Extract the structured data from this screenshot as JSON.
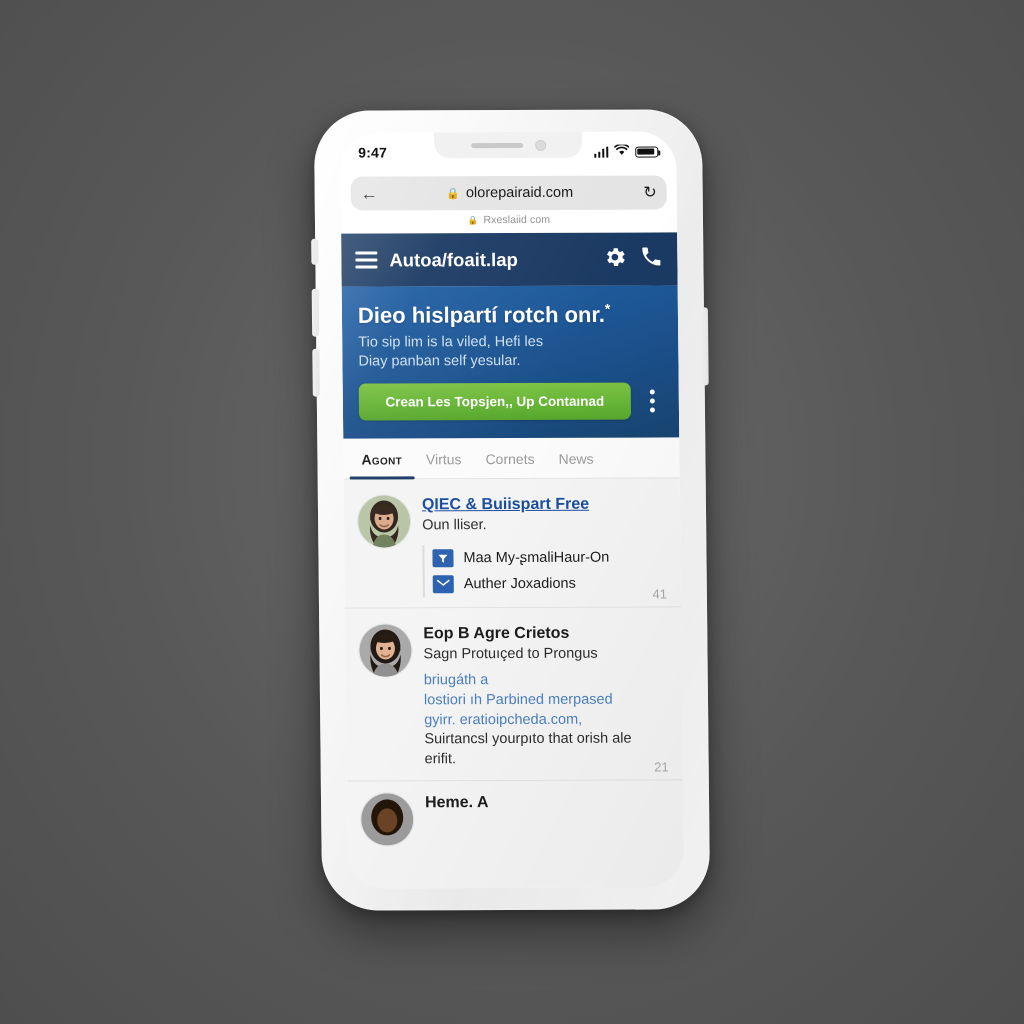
{
  "device": {
    "status_bar": {
      "time": "9:47",
      "signal_icon": "cellular-bars-icon",
      "wifi_icon": "wifi-icon",
      "battery_icon": "battery-icon"
    },
    "notch": {
      "speaker_icon": "speaker-grille-icon",
      "camera_icon": "front-camera-icon"
    },
    "buttons": {
      "silent_switch": "silent-switch",
      "volume_up": "volume-up-button",
      "volume_down": "volume-down-button",
      "power": "power-button"
    }
  },
  "browser": {
    "back_icon": "back-arrow-icon",
    "lock_icon": "lock-icon",
    "url": "olorepairaid.com",
    "reload_icon": "reload-icon",
    "sub_lock_icon": "lock-icon",
    "sub_url": "Rxeslaiid com"
  },
  "site_header": {
    "menu_icon": "hamburger-menu-icon",
    "title": "Autoa/foait.lap",
    "settings_icon": "gear-icon",
    "phone_icon": "phone-icon"
  },
  "hero": {
    "title": "Dieo hislpartí rotch onr.",
    "title_superscript": "*",
    "subtitle_line1": "Tio sip lim is la viled, Hefi les",
    "subtitle_line2": "Diay panban self yesular.",
    "cta_label": "Crean Les Topsjen,, Up Contaınad",
    "overflow_icon": "more-vertical-icon",
    "cta_color": "#68b637",
    "background_color": "#1d5796",
    "header_color": "#1b3a63"
  },
  "tabs": [
    {
      "label": "Agont",
      "active": true
    },
    {
      "label": "Virtus",
      "active": false
    },
    {
      "label": "Cornets",
      "active": false
    },
    {
      "label": "News",
      "active": false
    }
  ],
  "list": [
    {
      "avatar": "woman-avatar-1",
      "link_title": "QIEC & Buiispart Free",
      "subtitle": "Oun lliser.",
      "meta": [
        {
          "icon": "filter-badge-icon",
          "text": "Maa My-ʂmaliHaur-On"
        },
        {
          "icon": "envelope-icon",
          "text": "Auther Joxadions"
        }
      ],
      "count": "41"
    },
    {
      "avatar": "woman-avatar-2",
      "title": "Eop B Agre Crietos",
      "subtitle": "Sagn Protuıçed to Prongus",
      "blue_lines": [
        "briugáth a",
        "lostiori ıh Parbined merpased",
        "gyirr. eratioipcheda.com,"
      ],
      "dark_lines": [
        "Suirtancsl yourpıto that orish ale",
        "erifit."
      ],
      "count": "21"
    },
    {
      "avatar": "person-avatar-3",
      "title": "Heme. A"
    }
  ]
}
